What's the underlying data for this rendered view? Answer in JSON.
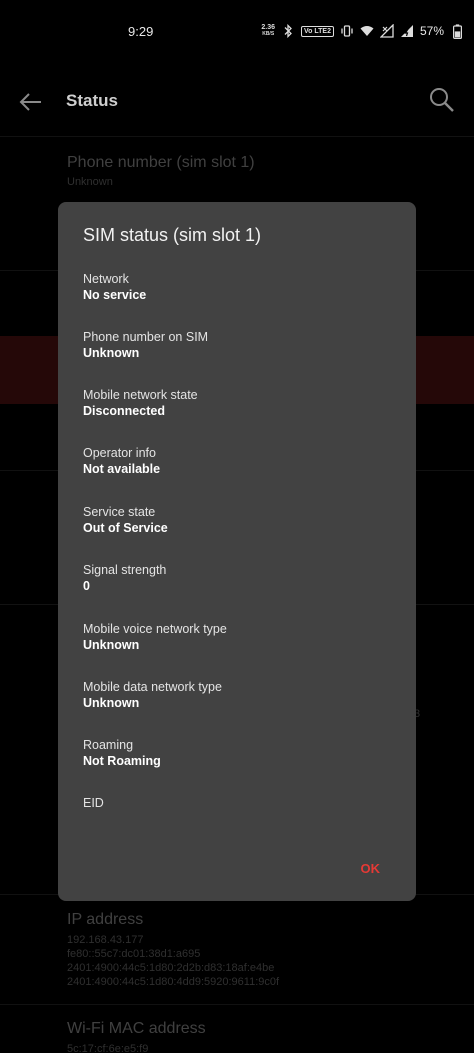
{
  "status_bar": {
    "time": "9:29",
    "net_speed_value": "2.36",
    "net_speed_unit": "KB/S",
    "volte": "Vo LTE2",
    "battery": "57%"
  },
  "app_bar": {
    "title": "Status"
  },
  "background_list": {
    "items": [
      {
        "title": "Phone number (sim slot 1)",
        "subtitle": "Unknown"
      },
      {
        "title": "IP address",
        "lines": [
          "192.168.43.177",
          "fe80::55c7:dc01:38d1:a695",
          "2401:4900:44c5:1d80:2d2b:d83:18af:e4be",
          "2401:4900:44c5:1d80:4dd9:5920:9611:9c0f"
        ]
      },
      {
        "title": "Wi-Fi MAC address",
        "subtitle": "5c:17:cf:6e:e5:f9"
      }
    ],
    "stray_char": "3"
  },
  "dialog": {
    "title": "SIM status (sim slot 1)",
    "fields": [
      {
        "label": "Network",
        "value": "No service"
      },
      {
        "label": "Phone number on SIM",
        "value": "Unknown"
      },
      {
        "label": "Mobile network state",
        "value": "Disconnected"
      },
      {
        "label": "Operator info",
        "value": "Not available"
      },
      {
        "label": "Service state",
        "value": "Out of Service"
      },
      {
        "label": "Signal strength",
        "value": "0"
      },
      {
        "label": "Mobile voice network type",
        "value": "Unknown"
      },
      {
        "label": "Mobile data network type",
        "value": "Unknown"
      },
      {
        "label": "Roaming",
        "value": "Not Roaming"
      },
      {
        "label": "EID",
        "value": ""
      }
    ],
    "ok_label": "OK"
  },
  "colors": {
    "background": "#000000",
    "dialog": "#424242",
    "accent": "#e53935"
  }
}
